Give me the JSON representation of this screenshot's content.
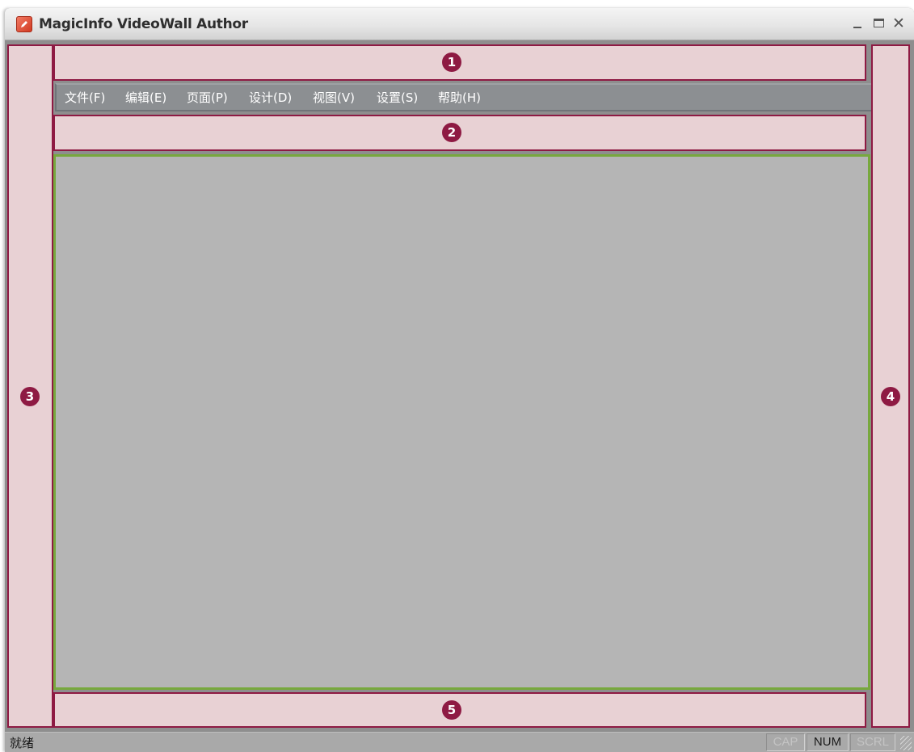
{
  "window": {
    "title": "MagicInfo VideoWall Author",
    "controls": {
      "minimize_icon": "minimize-icon",
      "maximize_icon": "maximize-icon",
      "close_label": "✕"
    }
  },
  "menubar": {
    "items": [
      {
        "label": "文件(F)"
      },
      {
        "label": "编辑(E)"
      },
      {
        "label": "页面(P)"
      },
      {
        "label": "设计(D)"
      },
      {
        "label": "视图(V)"
      },
      {
        "label": "设置(S)"
      },
      {
        "label": "帮助(H)"
      }
    ]
  },
  "zones": {
    "zone1": {
      "badge": "1"
    },
    "zone2": {
      "badge": "2"
    },
    "zone3": {
      "badge": "3"
    },
    "zone4": {
      "badge": "4"
    },
    "zone5": {
      "badge": "5"
    }
  },
  "statusbar": {
    "text": "就绪",
    "indicators": {
      "cap": "CAP",
      "num": "NUM",
      "scrl": "SCRL"
    }
  },
  "colors": {
    "highlight_zone": "#e8d1d4",
    "highlight_border": "#8e1a43",
    "canvas_border": "#77a83d",
    "canvas": "#b5b5b5"
  }
}
